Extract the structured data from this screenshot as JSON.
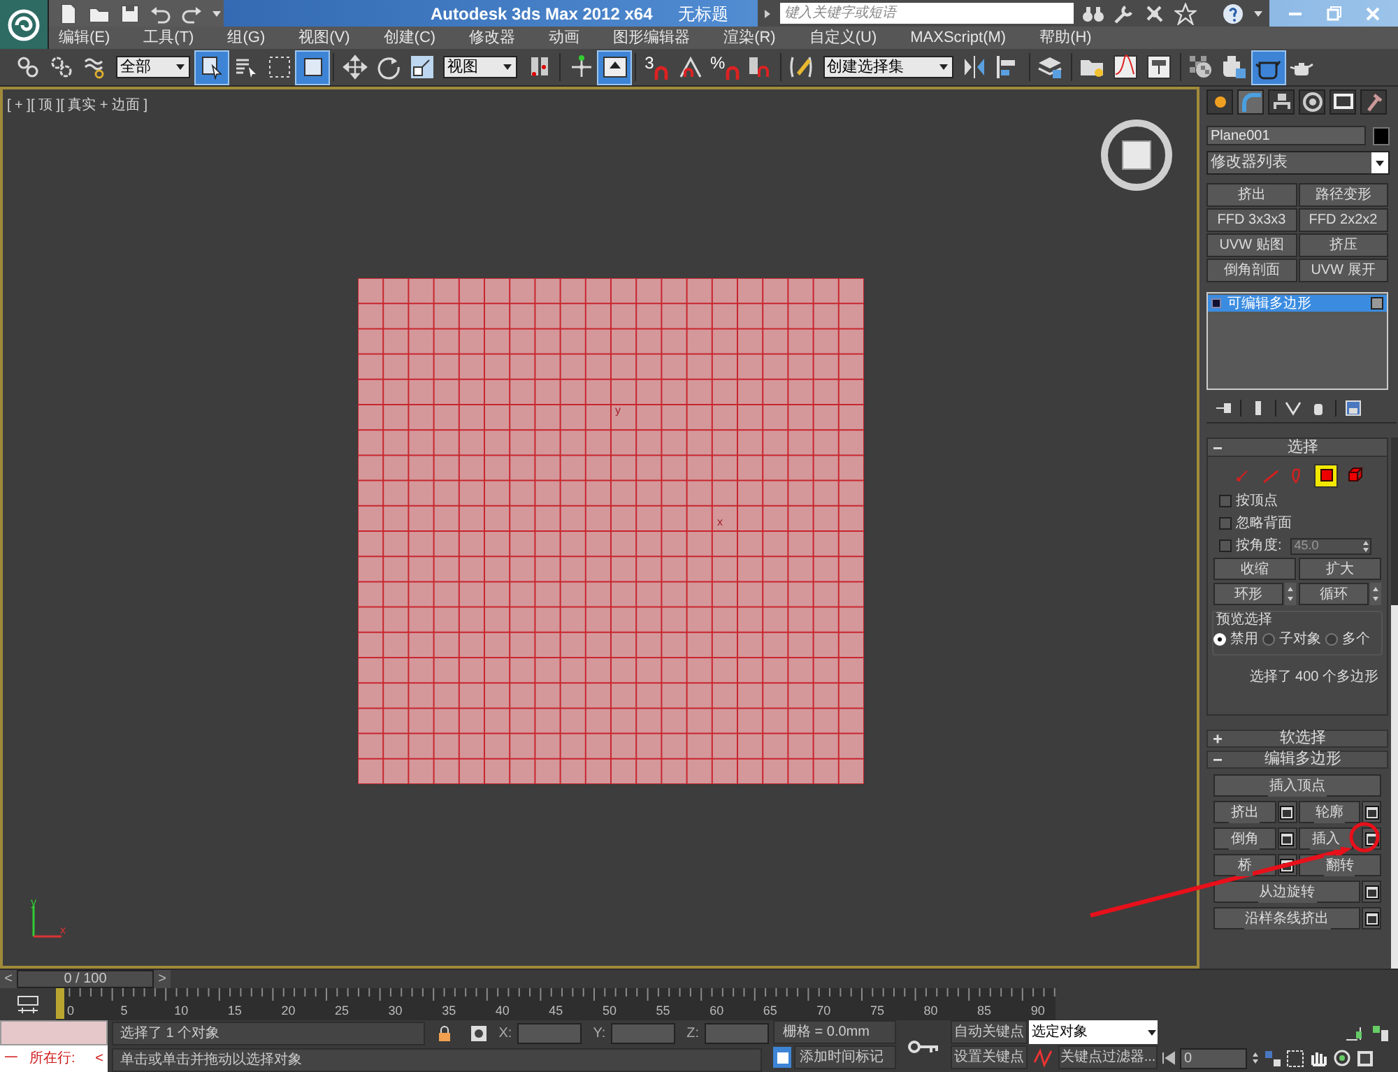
{
  "title_bar": {
    "title": "Autodesk 3ds Max  2012 x64",
    "document": "无标题",
    "search": {
      "placeholder": "键入关键字或短语"
    }
  },
  "menu": [
    "编辑(E)",
    "工具(T)",
    "组(G)",
    "视图(V)",
    "创建(C)",
    "修改器",
    "动画",
    "图形编辑器",
    "渲染(R)",
    "自定义(U)",
    "MAXScript(M)",
    "帮助(H)"
  ],
  "toolbar": [
    {
      "kind": "link",
      "selected": false
    },
    {
      "kind": "unlink",
      "selected": false
    },
    {
      "kind": "bind",
      "selected": false
    },
    {
      "kind": "dropdown",
      "value": "全部"
    },
    {
      "kind": "select",
      "selected": true
    },
    {
      "kind": "select-name",
      "selected": false
    },
    {
      "kind": "region",
      "selected": false
    },
    {
      "kind": "crossing",
      "selected": true
    },
    {
      "kind": "sep"
    },
    {
      "kind": "move",
      "selected": false
    },
    {
      "kind": "rotate",
      "selected": false
    },
    {
      "kind": "scale",
      "selected": false
    },
    {
      "kind": "dropdown",
      "value": "视图"
    },
    {
      "kind": "pivot",
      "selected": false
    },
    {
      "kind": "sep"
    },
    {
      "kind": "manipulate",
      "selected": false
    },
    {
      "kind": "keyboard",
      "selected": true
    },
    {
      "kind": "sep"
    },
    {
      "kind": "snap",
      "label": "3",
      "selected": false
    },
    {
      "kind": "angle-snap",
      "selected": false
    },
    {
      "kind": "snap",
      "label": "%",
      "selected": false
    },
    {
      "kind": "spinner-snap",
      "selected": false
    },
    {
      "kind": "sep"
    },
    {
      "kind": "named-sets",
      "selected": false
    },
    {
      "kind": "dropdown",
      "value": "创建选择集"
    },
    {
      "kind": "mirror",
      "selected": false
    },
    {
      "kind": "align",
      "selected": false
    },
    {
      "kind": "sep"
    },
    {
      "kind": "layers",
      "selected": false
    },
    {
      "kind": "sep"
    },
    {
      "kind": "scene",
      "selected": false
    },
    {
      "kind": "curve",
      "selected": false
    },
    {
      "kind": "schematic",
      "selected": false
    },
    {
      "kind": "sep"
    },
    {
      "kind": "material"
    },
    {
      "kind": "render-setup",
      "selected": false
    },
    {
      "kind": "frame-window",
      "selected": true
    },
    {
      "kind": "render",
      "selected": false
    }
  ],
  "viewport": {
    "label": "[ + ][ 顶 ][ 真实 + 边面 ]",
    "plane_marks": [
      "y",
      "x"
    ],
    "axis_labels": [
      "y",
      "x"
    ]
  },
  "command_panel": {
    "tabs": [
      {
        "kind": "create",
        "selected": false
      },
      {
        "kind": "modify",
        "selected": true
      },
      {
        "kind": "hierarchy",
        "selected": false
      },
      {
        "kind": "motion",
        "selected": false
      },
      {
        "kind": "display",
        "selected": false
      },
      {
        "kind": "utilities",
        "selected": false
      }
    ],
    "object_name": "Plane001",
    "modifier_list": "修改器列表",
    "modifier_buttons": [
      "挤出",
      "路径变形",
      "FFD 3x3x3",
      "FFD 2x2x2",
      "UVW 贴图",
      "挤压",
      "倒角剖面",
      "UVW 展开"
    ],
    "stack": [
      {
        "label": "可编辑多边形",
        "selected": true
      }
    ],
    "selection": {
      "title": "选择",
      "expanded": true,
      "levels": [
        {
          "kind": "vertex",
          "selected": false
        },
        {
          "kind": "edge",
          "selected": false
        },
        {
          "kind": "border",
          "selected": false
        },
        {
          "kind": "polygon",
          "selected": true
        },
        {
          "kind": "element",
          "selected": false
        }
      ],
      "checkboxes": [
        {
          "label": "按顶点",
          "checked": false
        },
        {
          "label": "忽略背面",
          "checked": false
        },
        {
          "label": "按角度:",
          "checked": false
        }
      ],
      "angle": "45.0",
      "shrink": "收缩",
      "grow": "扩大",
      "ring": "环形",
      "loop": "循环",
      "preview": {
        "title": "预览选择",
        "options": [
          {
            "label": "禁用",
            "selected": true
          },
          {
            "label": "子对象",
            "selected": false
          },
          {
            "label": "多个",
            "selected": false
          }
        ]
      },
      "status": "选择了 400 个多边形"
    },
    "rollouts": [
      {
        "title": "软选择",
        "expanded": false
      },
      {
        "title": "编辑多边形",
        "expanded": true
      }
    ],
    "edit_poly": [
      [
        {
          "label": "插入顶点",
          "settings": false
        }
      ],
      [
        {
          "label": "挤出",
          "settings": true
        },
        {
          "label": "轮廓",
          "settings": true
        }
      ],
      [
        {
          "label": "倒角",
          "settings": true
        },
        {
          "label": "插入",
          "settings": true
        }
      ],
      [
        {
          "label": "桥",
          "settings": true
        },
        {
          "label": "翻转",
          "settings": false
        }
      ],
      [
        {
          "label": "从边旋转",
          "settings": true
        }
      ],
      [
        {
          "label": "沿样条线挤出",
          "settings": true
        }
      ]
    ]
  },
  "time_slider": {
    "position": "0 / 100",
    "prev": "<",
    "next": ">"
  },
  "ruler_labels": [
    "0",
    "5",
    "10",
    "15",
    "20",
    "25",
    "30",
    "35",
    "40",
    "45",
    "50",
    "55",
    "60",
    "65",
    "70",
    "75",
    "80",
    "85",
    "90"
  ],
  "status_bar": {
    "listener": {
      "marker": "一",
      "line_label": "所在行:",
      "arrow": "<"
    },
    "prompt": "选择了 1 个对象",
    "hint": "单击或单击并拖动以选择对象",
    "coords": [
      {
        "axis": "X:"
      },
      {
        "axis": "Y:"
      },
      {
        "axis": "Z:"
      }
    ],
    "grid": "栅格 = 0.0mm",
    "time_tag": "添加时间标记",
    "auto_key": "自动关键点",
    "selection_set": "选定对象",
    "set_key": "设置关键点",
    "key_filters": "关键点过滤器...",
    "frame": "0"
  }
}
